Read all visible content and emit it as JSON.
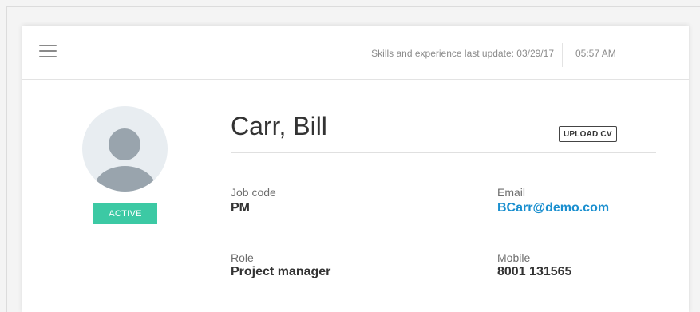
{
  "header": {
    "update_text": "Skills and experience last update: 03/29/17",
    "time": "05:57 AM"
  },
  "profile": {
    "status": "ACTIVE",
    "name": "Carr, Bill",
    "upload_label": "UPLOAD CV",
    "fields": {
      "job_code": {
        "label": "Job code",
        "value": "PM"
      },
      "email": {
        "label": "Email",
        "value": "BCarr@demo.com"
      },
      "role": {
        "label": "Role",
        "value": "Project manager"
      },
      "mobile": {
        "label": "Mobile",
        "value": "8001 131565"
      }
    }
  },
  "colors": {
    "status_badge": "#3cc9a4",
    "link": "#1a8fcf",
    "avatar_bg": "#e8edf1",
    "avatar_fg": "#99a4ad"
  },
  "icons": {
    "menu": "hamburger-menu-icon",
    "avatar": "person-placeholder-icon"
  }
}
